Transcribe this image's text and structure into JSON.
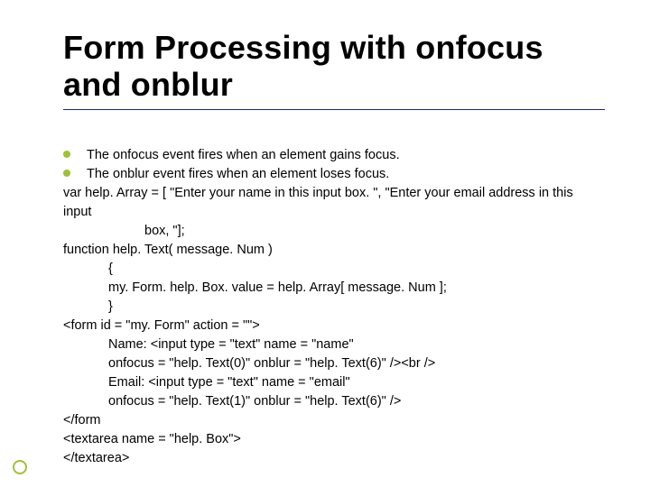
{
  "title": "Form Processing with onfocus and onblur",
  "bullets": [
    "The onfocus event fires when an element gains focus.",
    "The onblur event fires when an element loses focus."
  ],
  "code": {
    "l1": "var help. Array = [ \"Enter your name in this input box. \", \"Enter your email address in this input",
    "l2": "box, \"];",
    "l3": "function help. Text( message. Num )",
    "l4": "{",
    "l5": "my. Form. help. Box. value = help. Array[ message. Num ];",
    "l6": "}",
    "l7": "<form id = \"my. Form\" action = \"\">",
    "l8": "Name: <input type = \"text\" name = \"name\"",
    "l9": "onfocus = \"help. Text(0)\" onblur = \"help. Text(6)\" /><br />",
    "l10": "Email: <input type = \"text\" name = \"email\"",
    "l11": "onfocus = \"help. Text(1)\" onblur = \"help. Text(6)\" />",
    "l12": "</form",
    "l13": "<textarea name = \"help. Box\">",
    "l14": "</textarea>"
  }
}
